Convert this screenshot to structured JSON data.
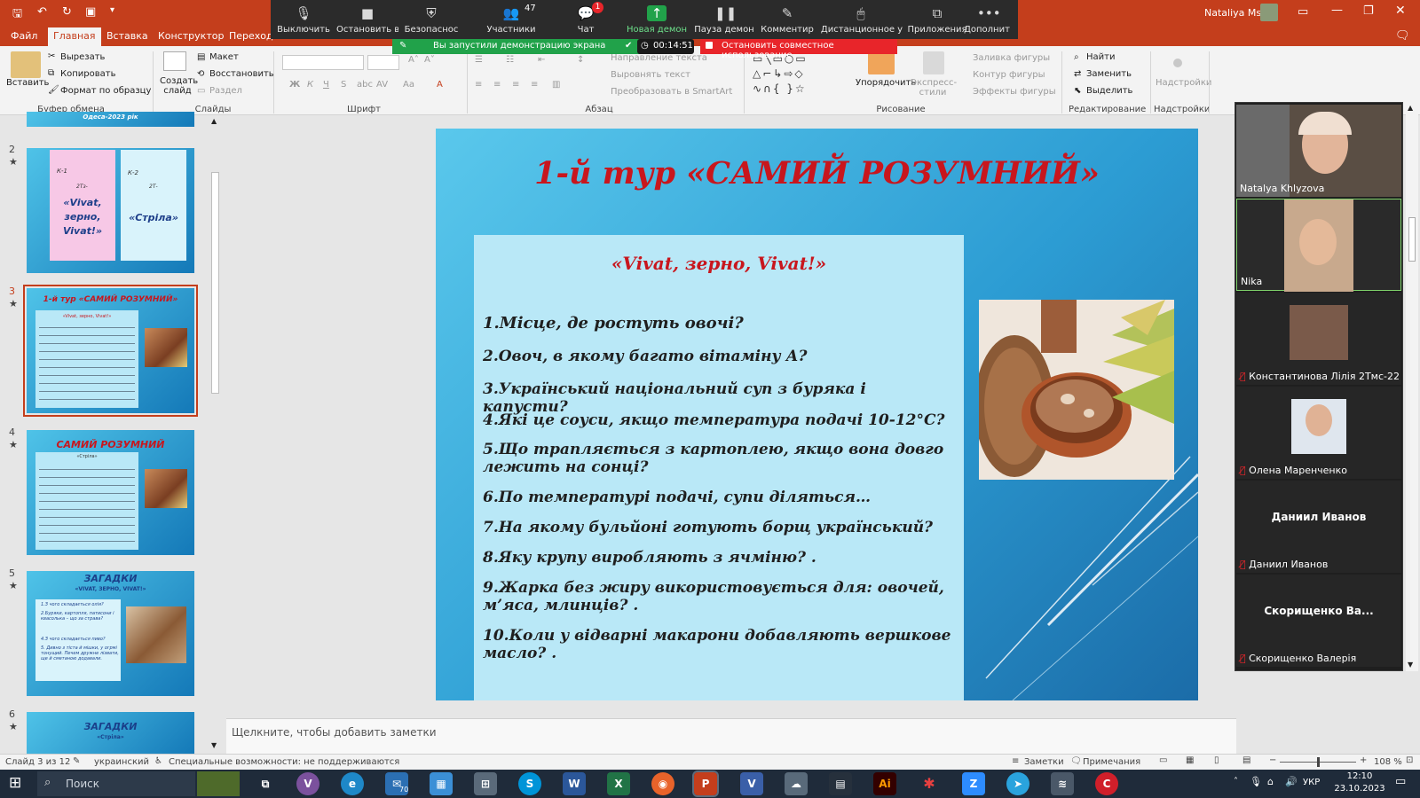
{
  "titlebar": {
    "user": "Nataliya Ms"
  },
  "tabs": [
    "Файл",
    "Главная",
    "Вставка",
    "Конструктор",
    "Переходы"
  ],
  "zoom": {
    "buttons": [
      {
        "label": "Выключить",
        "icon": "microphone-icon"
      },
      {
        "label": "Остановить в",
        "icon": "camera-icon"
      },
      {
        "label": "Безопаснос",
        "icon": "shield-icon"
      },
      {
        "label": "Участники",
        "icon": "participants-icon",
        "count": "47"
      },
      {
        "label": "Чат",
        "icon": "chat-icon",
        "badge": "1"
      },
      {
        "label": "Новая демон",
        "icon": "share-screen-icon"
      },
      {
        "label": "Пауза демон",
        "icon": "pause-icon"
      },
      {
        "label": "Комментир",
        "icon": "pencil-icon"
      },
      {
        "label": "Дистанционное у",
        "icon": "mouse-icon"
      },
      {
        "label": "Приложения",
        "icon": "apps-icon"
      },
      {
        "label": "Дополнит",
        "icon": "more-icon"
      }
    ],
    "share_banner": "Вы запустили демонстрацию экрана",
    "timer": "00:14:51",
    "stop_share": "Остановить совместное использование"
  },
  "ribbon": {
    "clipboard": {
      "paste": "Вставить",
      "cut": "Вырезать",
      "copy": "Копировать",
      "format": "Формат по образцу",
      "group": "Буфер обмена"
    },
    "slides": {
      "new": "Создать слайд",
      "layout": "Макет",
      "reset": "Восстановить",
      "section": "Раздел",
      "group": "Слайды"
    },
    "font": {
      "group": "Шрифт"
    },
    "paragraph": {
      "direction": "Направление текста",
      "align": "Выровнять текст",
      "smartart": "Преобразовать в SmartArt",
      "group": "Абзац"
    },
    "drawing": {
      "arrange": "Упорядочить",
      "styles": "Экспресс-стили",
      "fill": "Заливка фигуры",
      "outline": "Контур фигуры",
      "effects": "Эффекты фигуры",
      "group": "Рисование"
    },
    "editing": {
      "find": "Найти",
      "replace": "Заменить",
      "select": "Выделить",
      "group": "Редактирование"
    },
    "addins": {
      "label": "Надстройки",
      "group": "Надстройки"
    }
  },
  "thumbnails": {
    "top_fragment": "Одеса-2023 рік",
    "slides": [
      {
        "num": "2",
        "k1": "К-1",
        "k1_group": "2Тз-",
        "k1_title": "«Vivat, зерно, Vivat!»",
        "k2": "К-2",
        "k2_group": "2Т-",
        "k2_title": "«Стріла»"
      },
      {
        "num": "3",
        "title": "1-й тур «САМИЙ РОЗУМНИЙ»",
        "sub": "«Vivat, зерно, Vivat!»"
      },
      {
        "num": "4",
        "title": "САМИЙ РОЗУМНИЙ",
        "sub": "«Стріла»"
      },
      {
        "num": "5",
        "title": "ЗАГАДКИ",
        "sub": "«VIVAT, ЗЕРНО, VIVAT!»",
        "lines": [
          "1.З чого складається олія?",
          "2.Буряки, картопля, патисони і квасолька – що за страва?",
          "4.З чого складається пиво?",
          "5. Дивно з тіста й мішки, у огрмі тонущий. Печем дружне лізвати, ще й сметаною додавали."
        ]
      },
      {
        "num": "6",
        "title": "ЗАГАДКИ",
        "sub": "«Стріла»"
      }
    ]
  },
  "slide": {
    "title": "1-й тур «САМИЙ РОЗУМНИЙ»",
    "subtitle": "«Vivat, зерно, Vivat!»",
    "questions": [
      "1.Місце, де ростуть овочі?",
      "2.Овоч, в якому багато вітаміну А?",
      "3.Український національний суп з буряка і капусти?",
      "4.Які це соуси, якщо температура подачі 10-12°С?",
      "5.Що трапляється з картоплею, якщо вона довго лежить на сонці?",
      "6.По температурі подачі, супи діляться…",
      "7.На якому бульйоні готують борщ український?",
      "8.Яку крупу виробляють з ячміню? .",
      "9.Жарка без жиру використовується для: овочей, м’яса, млинців? .",
      "10.Коли у відварні макарони добавляють вершкове масло? ."
    ]
  },
  "notes_placeholder": "Щелкните, чтобы добавить заметки",
  "participants": [
    {
      "name": "Natalya Khlyzova",
      "video": true
    },
    {
      "name": "Nika",
      "video": true
    },
    {
      "name": "Константинова Лілія 2Тмс-22",
      "video": true,
      "muted": true
    },
    {
      "name": "Олена Маренченко",
      "video": true,
      "muted": true
    },
    {
      "name": "Даниил Иванов",
      "big": "Даниил Иванов",
      "video": false,
      "muted": true
    },
    {
      "name": "Скорищенко Валерія",
      "big": "Скорищенко Ва...",
      "video": false,
      "muted": true
    }
  ],
  "status": {
    "slide": "Слайд 3 из 12",
    "lang": "украинский",
    "access": "Специальные возможности: не поддерживаются",
    "notes": "Заметки",
    "comments": "Примечания",
    "zoom": "108 %"
  },
  "taskbar": {
    "search": "Поиск",
    "mail_badge": "70",
    "time": "12:10",
    "date": "23.10.2023",
    "lang": "УКР"
  }
}
